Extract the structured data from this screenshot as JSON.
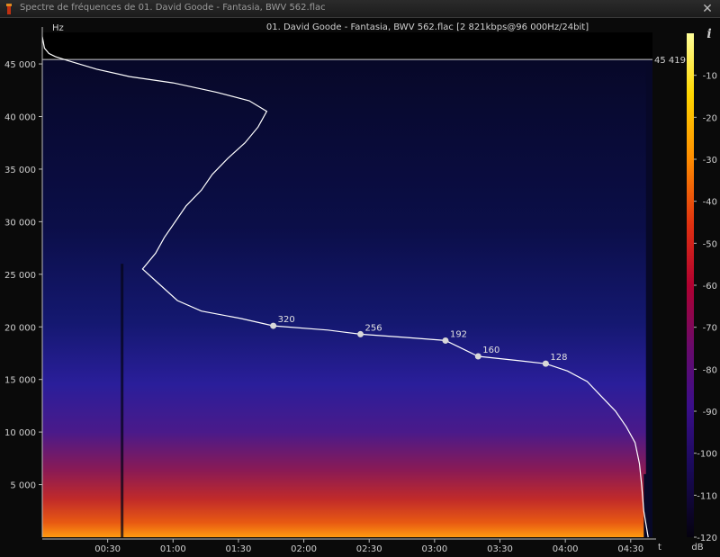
{
  "window": {
    "title": "Spectre de fréquences de 01. David Goode - Fantasia, BWV 562.flac",
    "close_icon": "close-icon",
    "app_icon": "spectrum-app-icon"
  },
  "plot": {
    "header": "01. David Goode - Fantasia, BWV 562.flac [2 821kbps@96 000Hz/24bit]",
    "y_unit": "Hz",
    "x_unit": "t",
    "cutoff_label": "45 419",
    "info_label": "i"
  },
  "colorbar": {
    "unit": "dB",
    "stops": [
      "#ffff99",
      "#ffd700",
      "#ff8c00",
      "#e03010",
      "#b00030",
      "#6a0a6a",
      "#3a0e8a",
      "#1a0a5a",
      "#05020f"
    ]
  },
  "chart_data": {
    "type": "heatmap",
    "title": "01. David Goode - Fantasia, BWV 562.flac [2 821kbps@96 000Hz/24bit]",
    "xlabel": "t",
    "ylabel": "Hz",
    "x_ticks": [
      "00:30",
      "01:00",
      "01:30",
      "02:00",
      "02:30",
      "03:00",
      "03:30",
      "04:00",
      "04:30"
    ],
    "x_tick_seconds": [
      30,
      60,
      90,
      120,
      150,
      180,
      210,
      240,
      270
    ],
    "xlim": [
      0,
      280
    ],
    "y_ticks": [
      "5 000",
      "10 000",
      "15 000",
      "20 000",
      "25 000",
      "30 000",
      "35 000",
      "40 000",
      "45 000"
    ],
    "y_tick_values": [
      5000,
      10000,
      15000,
      20000,
      25000,
      30000,
      35000,
      40000,
      45000
    ],
    "ylim": [
      0,
      48000
    ],
    "cutoff_frequency": 45419,
    "colorbar_ticks": [
      "-10",
      "-20",
      "-30",
      "-40",
      "-50",
      "-60",
      "-70",
      "-80",
      "-90",
      "-100",
      "-110",
      "-120"
    ],
    "colorbar_values": [
      -10,
      -20,
      -30,
      -40,
      -50,
      -60,
      -70,
      -80,
      -90,
      -100,
      -110,
      -120
    ],
    "colorbar_range": [
      -120,
      0
    ],
    "bitrate_markers": [
      {
        "label": "320",
        "t": 106,
        "hz": 20100
      },
      {
        "label": "256",
        "t": 146,
        "hz": 19300
      },
      {
        "label": "192",
        "t": 185,
        "hz": 18700
      },
      {
        "label": "160",
        "t": 200,
        "hz": 17200
      },
      {
        "label": "128",
        "t": 231,
        "hz": 16500
      }
    ],
    "max_frequency_trace": [
      [
        0,
        47600
      ],
      [
        1,
        46500
      ],
      [
        3,
        46000
      ],
      [
        6,
        45700
      ],
      [
        12,
        45300
      ],
      [
        25,
        44500
      ],
      [
        40,
        43800
      ],
      [
        60,
        43200
      ],
      [
        80,
        42300
      ],
      [
        95,
        41500
      ],
      [
        103,
        40500
      ],
      [
        99,
        39000
      ],
      [
        93,
        37500
      ],
      [
        85,
        36000
      ],
      [
        78,
        34500
      ],
      [
        73,
        33000
      ],
      [
        66,
        31500
      ],
      [
        61,
        30000
      ],
      [
        56,
        28500
      ],
      [
        52,
        27000
      ],
      [
        46,
        25500
      ],
      [
        54,
        24000
      ],
      [
        62,
        22500
      ],
      [
        73,
        21500
      ],
      [
        91,
        20800
      ],
      [
        106,
        20100
      ],
      [
        131,
        19700
      ],
      [
        146,
        19300
      ],
      [
        166,
        19000
      ],
      [
        185,
        18700
      ],
      [
        200,
        17200
      ],
      [
        218,
        16800
      ],
      [
        231,
        16500
      ],
      [
        241,
        15800
      ],
      [
        250,
        14800
      ],
      [
        256,
        13500
      ],
      [
        263,
        12000
      ],
      [
        268,
        10500
      ],
      [
        272,
        9000
      ],
      [
        274,
        7000
      ],
      [
        275,
        5000
      ],
      [
        276,
        2500
      ],
      [
        278,
        0
      ]
    ]
  }
}
